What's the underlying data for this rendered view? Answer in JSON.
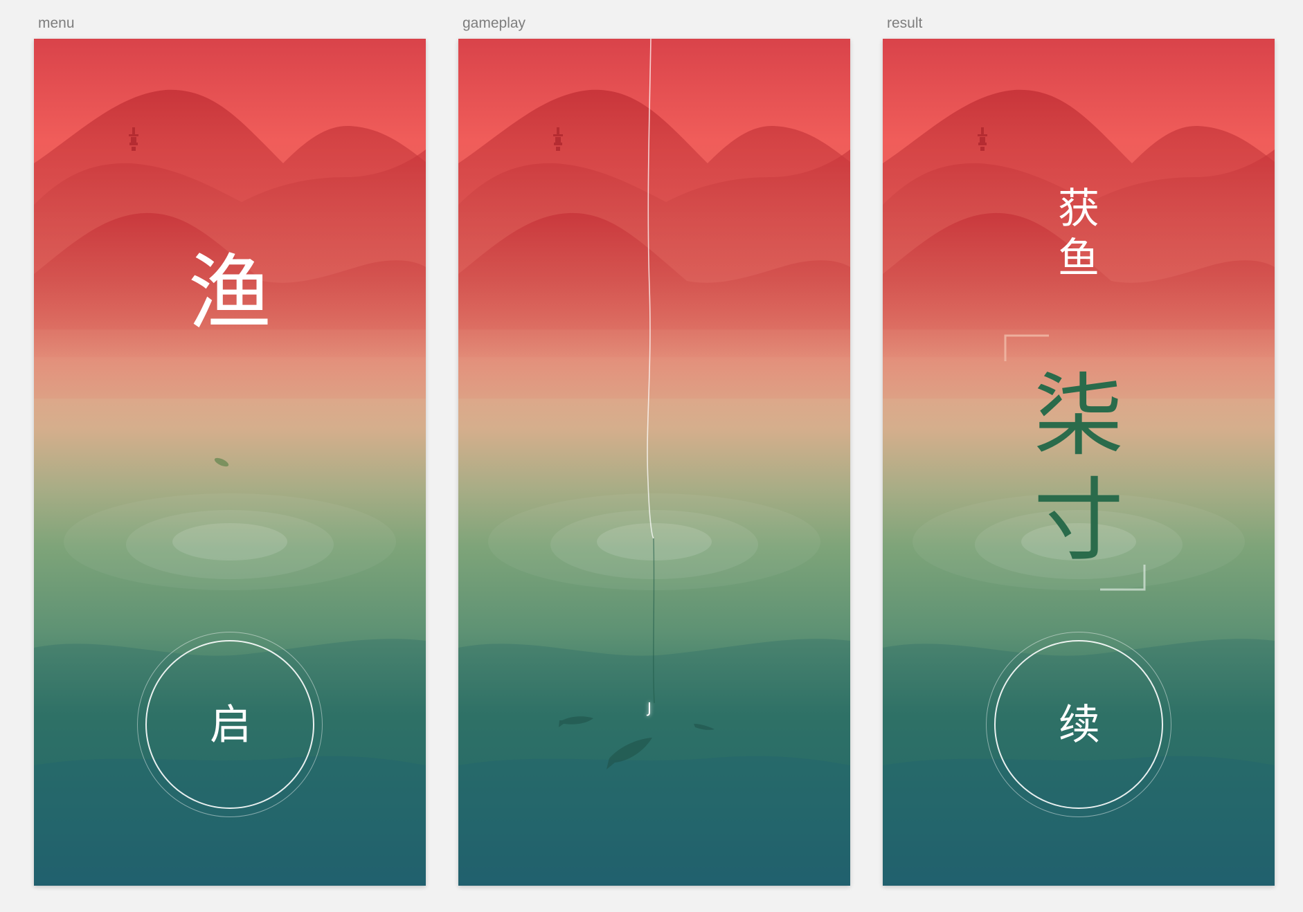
{
  "panels": {
    "menu": {
      "label": "menu",
      "title": "渔",
      "start_button": "启"
    },
    "gameplay": {
      "label": "gameplay",
      "hook_glyph": "J"
    },
    "result": {
      "label": "result",
      "heading_line1": "获",
      "heading_line2": "鱼",
      "size_line1": "柒",
      "size_line2": "寸",
      "continue_button": "续"
    }
  },
  "colors": {
    "sky_top": "#d9434a",
    "sky_mid": "#f05d5a",
    "horizon": "#e8a088",
    "water_green": "#6e9c75",
    "water_teal": "#2a6a66",
    "water_deep": "#1d5a70",
    "mountain": "#c4303a",
    "result_text": "#2a6b4b"
  }
}
